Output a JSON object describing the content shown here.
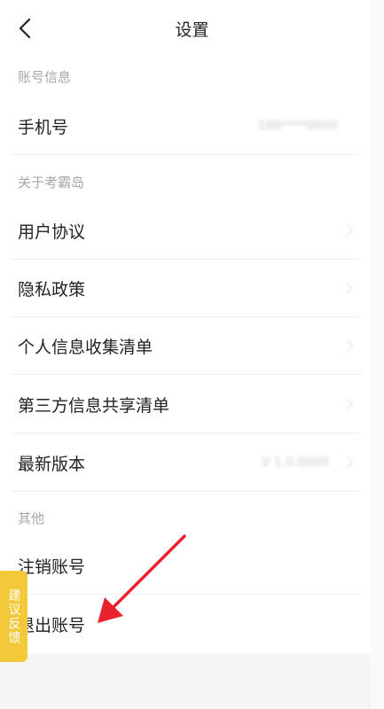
{
  "header": {
    "title": "设置",
    "back_icon": "chevron-left-icon"
  },
  "sections": [
    {
      "label": "账号信息"
    },
    {
      "label": "关于考霸岛"
    },
    {
      "label": "其他"
    }
  ],
  "rows": {
    "phone": {
      "label": "手机号",
      "value": "188****0000"
    },
    "user_agreement": {
      "label": "用户协议"
    },
    "privacy_policy": {
      "label": "隐私政策"
    },
    "personal_info_list": {
      "label": "个人信息收集清单"
    },
    "third_party_list": {
      "label": "第三方信息共享清单"
    },
    "latest_version": {
      "label": "最新版本",
      "value": "V 1.0.0000"
    },
    "delete_account": {
      "label": "注销账号"
    },
    "logout": {
      "label": "退出账号"
    }
  },
  "feedback": {
    "label": "建议反馈"
  },
  "colors": {
    "accent_yellow": "#f3c93a",
    "annotation_red": "#e8232e",
    "section_gray": "#a6a6a6",
    "divider": "#efefef"
  }
}
